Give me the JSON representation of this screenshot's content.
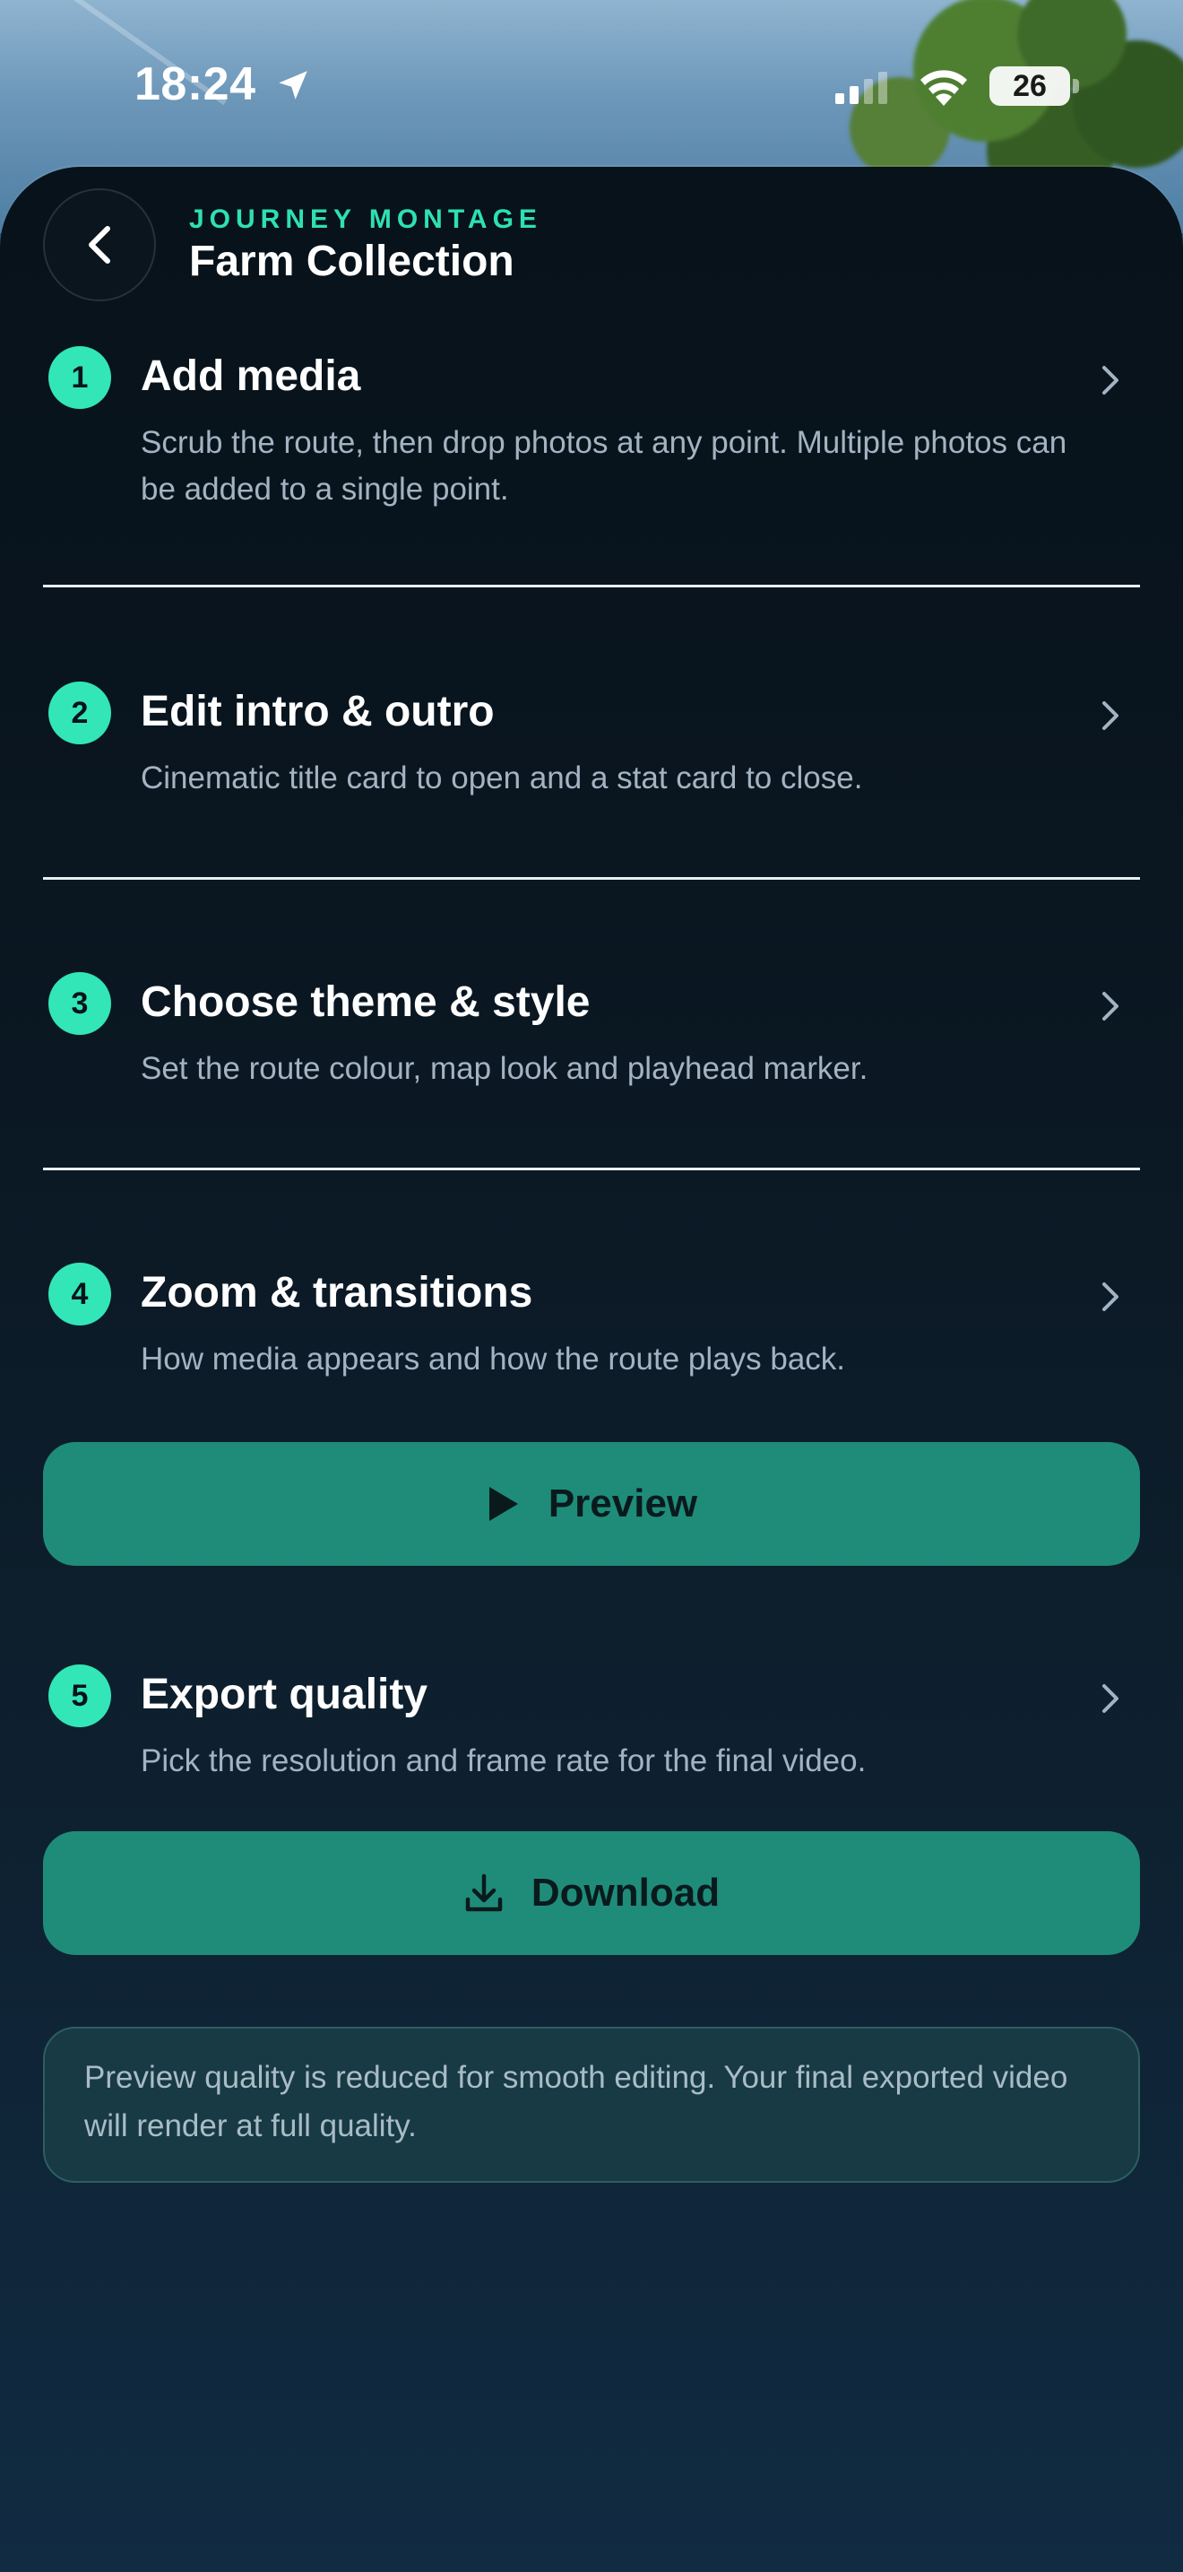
{
  "status_bar": {
    "time": "18:24",
    "battery": "26"
  },
  "header": {
    "eyebrow": "JOURNEY MONTAGE",
    "title": "Farm Collection"
  },
  "steps": [
    {
      "number": "1",
      "title": "Add media",
      "description": "Scrub the route, then drop photos at any point. Multiple photos can be added to a single point."
    },
    {
      "number": "2",
      "title": "Edit intro & outro",
      "description": "Cinematic title card to open and a stat card to close."
    },
    {
      "number": "3",
      "title": "Choose theme & style",
      "description": "Set the route colour, map look and playhead marker."
    },
    {
      "number": "4",
      "title": "Zoom & transitions",
      "description": "How media appears and how the route plays back."
    },
    {
      "number": "5",
      "title": "Export quality",
      "description": "Pick the resolution and frame rate for the final video."
    }
  ],
  "buttons": {
    "preview": "Preview",
    "download": "Download"
  },
  "note": "Preview quality is reduced for smooth editing. Your final exported video will render at full quality.",
  "colors": {
    "accent": "#33e6b7",
    "button": "#1f8c7a",
    "sheet": "#0a1620"
  }
}
